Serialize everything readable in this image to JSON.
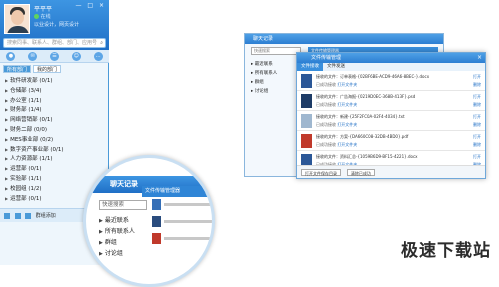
{
  "im": {
    "username": "平平平",
    "status_label": "在线",
    "signature": "以业设计，网页设计",
    "window_controls": "— □ ×",
    "search_placeholder": "搜索同事、联系人、群组、部门、应用号",
    "icon_tabs": [
      "●",
      "✉",
      "☰",
      "☺",
      "…"
    ],
    "dept_tabs": [
      "所有部门",
      "我的部门"
    ],
    "departments": [
      "软件研发部 (0/1)",
      "仓储部 (3/4)",
      "办公室 (1/1)",
      "财务部 (1/4)",
      "网络营销部 (0/1)",
      "财务二部 (0/0)",
      "MES事业部 (0/2)",
      "数字资产事业部 (0/1)",
      "人力资源部 (1/1)",
      "运营部 (0/1)",
      "实验部 (1/1)",
      "校园组 (1/2)",
      "运营部 (0/1)"
    ],
    "bottom_label": "群组添加"
  },
  "magnifier": {
    "title": "聊天记录",
    "sub_tab": "文件传输管理器",
    "search": "快速搜索",
    "tree": [
      "最近联系",
      "所有联系人",
      "群组",
      "讨论组"
    ]
  },
  "chat_window": {
    "title": "聊天记录",
    "search": "快速搜索",
    "tab": "文件传输管理器",
    "tree": [
      "最近联系",
      "所有联系人",
      "群组",
      "讨论组"
    ]
  },
  "file_manager": {
    "title": "文件传输管理",
    "close": "×",
    "tabs": [
      "文件接收",
      "文件发送"
    ],
    "files": [
      {
        "type": "doc",
        "meta": "接收的文件：订单表格-{02BF6BE-ACD9-46A6-8BEC-}.docx",
        "status": "已成功接收",
        "link": "打开文件夹",
        "act1": "打开",
        "act2": "删除"
      },
      {
        "type": "ps",
        "meta": "接收的文件：广告海报-{0219D0EC-368B-413F}.psd",
        "status": "已成功接收",
        "link": "打开文件夹",
        "act1": "打开",
        "act2": "删除"
      },
      {
        "type": "txt",
        "meta": "接收的文件：新建-{25F2FC0A-02F4-4034}.txt",
        "status": "已成功接收",
        "link": "打开文件夹",
        "act1": "打开",
        "act2": "删除"
      },
      {
        "type": "pdf",
        "meta": "接收的文件：方案-{DA660C08-32DB-4BD0}.pdf",
        "status": "已成功接收",
        "link": "打开文件夹",
        "act1": "打开",
        "act2": "删除"
      },
      {
        "type": "doc",
        "meta": "接收的文件：资料汇总-{1059B6D9-BF15-4221}.docx",
        "status": "已成功接收",
        "link": "打开文件夹",
        "act1": "打开",
        "act2": "删除"
      }
    ],
    "footer_buttons": [
      "打开文件保存目录",
      "清除已成功"
    ]
  },
  "watermark": "极速下载站",
  "colors": {
    "accent": "#2c7ed2",
    "header": "#1f6fc6",
    "online": "#5fd35f"
  }
}
